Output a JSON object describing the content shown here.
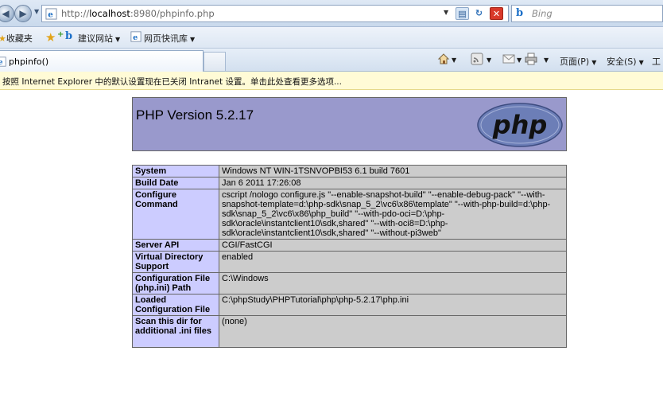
{
  "browser": {
    "url": {
      "prefix": "http://",
      "host": "localhost",
      "rest": ":8980/phpinfo.php"
    },
    "search": {
      "placeholder": "Bing"
    },
    "favorites_bar": {
      "favorites_label": "收藏夹",
      "suggested_sites_label": "建议网站",
      "web_slice_label": "网页快讯库"
    },
    "tab": {
      "title": "phpinfo()"
    },
    "command_bar": {
      "page_label": "页面(P)",
      "safety_label": "安全(S)",
      "tools_label": "工"
    },
    "info_bar": {
      "message": "按照 Internet Explorer 中的默认设置现在已关闭 Intranet 设置。单击此处查看更多选项..."
    },
    "accent_colors": {
      "php_header": "#9999cc",
      "key_cell": "#ccccff",
      "value_cell": "#cccccc",
      "info_bar": "#fffbd6"
    }
  },
  "phpinfo": {
    "version_title": "PHP Version 5.2.17",
    "logo_text": "php",
    "rows": [
      {
        "key": "System",
        "value": "Windows NT WIN-1TSNVOPBI53 6.1 build 7601"
      },
      {
        "key": "Build Date",
        "value": "Jan 6 2011 17:26:08"
      },
      {
        "key": "Configure Command",
        "value": "cscript /nologo configure.js \"--enable-snapshot-build\" \"--enable-debug-pack\" \"--with-snapshot-template=d:\\php-sdk\\snap_5_2\\vc6\\x86\\template\" \"--with-php-build=d:\\php-sdk\\snap_5_2\\vc6\\x86\\php_build\" \"--with-pdo-oci=D:\\php-sdk\\oracle\\instantclient10\\sdk,shared\" \"--with-oci8=D:\\php-sdk\\oracle\\instantclient10\\sdk,shared\" \"--without-pi3web\""
      },
      {
        "key": "Server API",
        "value": "CGI/FastCGI"
      },
      {
        "key": "Virtual Directory Support",
        "value": "enabled"
      },
      {
        "key": "Configuration File (php.ini) Path",
        "value": "C:\\Windows"
      },
      {
        "key": "Loaded Configuration File",
        "value": "C:\\phpStudy\\PHPTutorial\\php\\php-5.2.17\\php.ini"
      },
      {
        "key": "Scan this dir for additional .ini files",
        "value": "(none)"
      }
    ]
  }
}
